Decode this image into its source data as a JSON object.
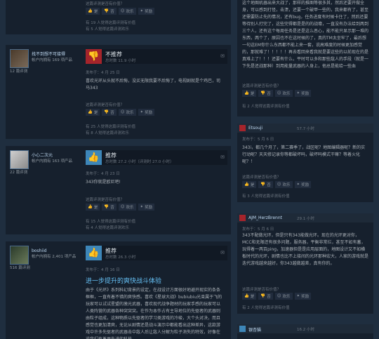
{
  "vote_labels": {
    "yes": "是",
    "no": "否",
    "funny": "欢乐",
    "award": "奖励"
  },
  "top_fragment": {
    "helpful_q": "这篇评测是否有价值？",
    "helpful_count": "有 19 人觉得这篇评测有价值",
    "funny_count": "有 5 人觉得这篇评测欢乐"
  },
  "review1": {
    "user_name": "找不到想不可接得",
    "owned": "帐户内拥有 169 项产品",
    "reviews": "12 篇评测",
    "verdict": "不推荐",
    "hours": "总时数 11.9 小时",
    "posted": "发布于：4 月 25 日",
    "text": "喜欢光环从头就不后悔，没买无限我要不后悔了，电视剧就是个鸡巴，司马343",
    "helpful_q": "这篇评测是否有价值？",
    "helpful_count": "有 25 人觉得这篇评测有价值",
    "funny_count": "有 8 人觉得这篇评测欢乐"
  },
  "review2": {
    "user_name": "小心二次元",
    "owned": "帐户内拥有 163 项产品",
    "reviews": "22 篇评测",
    "verdict": "推荐",
    "hours": "总时数 27.2 小时（评测时 27.0 小时）",
    "posted": "发布于：4 月 23 日",
    "text": "343你就是欧尼吧!",
    "helpful_q": "这篇评测是否有价值？",
    "helpful_count": "有 15 人觉得这篇评测有价值",
    "funny_count": "有 4 人觉得这篇评测欢乐"
  },
  "review3": {
    "user_name": "boshiid",
    "owned": "帐户内拥有 2,401 项产品",
    "reviews": "516 篇评测",
    "verdict": "推荐",
    "hours": "总时数 26.3 小时",
    "posted": "发布于：4 月 16 日",
    "title": "进一步提升的爽快战斗体验",
    "text": "由于《光环》系列科幻背景的设定，在战设计方面很好地避开现实的条条框框，一直有着不错的爽快感。喜欢《星球大战》bubiubiu光束属于飞的玩家可以试试星盟的激光武器，喜欢现代战争题材的玩家手感的玩家可以人类阵营的武器各种突突突。在作为本作占有主导地位的先驱者的武器则由粒子组成，这种物质以先驱者的学习类游戏的冷峻，大个头对决，而且感觉也更加清爽，无论从剧情还是战斗演示中都能看出这种差异，这款游戏中许多先驱者的武器击中敌人后让敌人分解为粒子消失的特效，好像在说我们有着更先进的科技。"
  },
  "side_top": {
    "text": "这个地图机器出来大战了，那样的推图等很多其，然后还要开做全身，可以感到打怪，击溃，还要一个破甲一些的，我来都有了，甚至还需要防止先的情况，还有bug，任务进度有时候卡住了，然后还要等待别人打完了，这些完得都是是的的战壕，一直没有办法给到两到三个人，还有这个每周任务是还是这么恶心，能不能只显示那一堆的东西，两个了，原因也不在这时候的了，真的TM太坐牢了，最后想一句这EM你什么东西都不能上来一套，说高难度的时候更加感觉的，那就难了！！！！！再去看回来看我就是要这些的以前现在的是真难上了！！！还要有什么，平时可以多和那些敌人的手段（就是一下先是还战那种）到用能量武器的人身上，他总是能给一些血",
    "helpful_q": "这篇评测是否有价值？",
    "helpful_count": "有 2 人觉得这篇评测有价值"
  },
  "side1": {
    "name": "Etsouji",
    "hours": "57.7 小时",
    "posted": "发布于：5 月 6 日",
    "text": "343i，都几个月了，第二赛季了，战区呢？地图编辑器呢？新的实行动呢？天天修记录你等都破坏吗，破坏吗模式干嘛？等着火化呢？！",
    "helpful_q": "这篇评测是否有价值？",
    "helpful_count": "有 3 人觉得这篇评测有价值"
  },
  "side2": {
    "name": "AJM_HerzBrennt",
    "hours": "29.1 小时",
    "posted": "发布于：5 月 6 日",
    "text": "343不配做光环，但是只有343能做光环。现在的光环更对你，MCC和无限还有很多问题，服务器，平衡非常烂，甚至不如有蓄，玩得着一两百ping，加速器但是是应用层面的，地图设计又不如横板时代的光环，剧情也比不上接间的光环那种宏大，人家的游戏就是迭代游戏越来越好，你343越做越差，真有你的。",
    "helpful_q": "这篇评测是否有价值？",
    "helpful_count": "有 2 人觉得这篇评测有价值"
  },
  "side3": {
    "name": "银杏猫",
    "hours": "16.2 小时"
  }
}
